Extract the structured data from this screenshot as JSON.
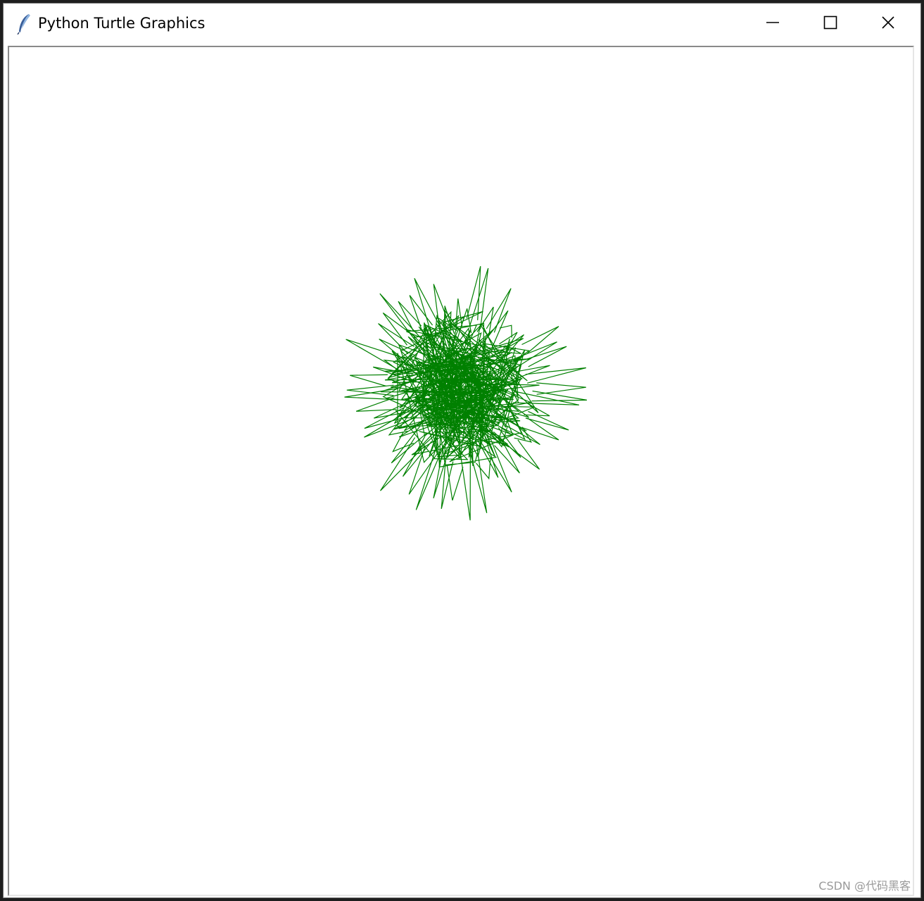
{
  "window": {
    "title": "Python Turtle Graphics",
    "icon": "feather-icon"
  },
  "controls": {
    "minimize_icon": "minimize-icon",
    "maximize_icon": "maximize-icon",
    "close_icon": "close-icon"
  },
  "drawing": {
    "stroke_color": "#008000",
    "background": "#ffffff"
  },
  "watermark": "CSDN @代码黑客"
}
